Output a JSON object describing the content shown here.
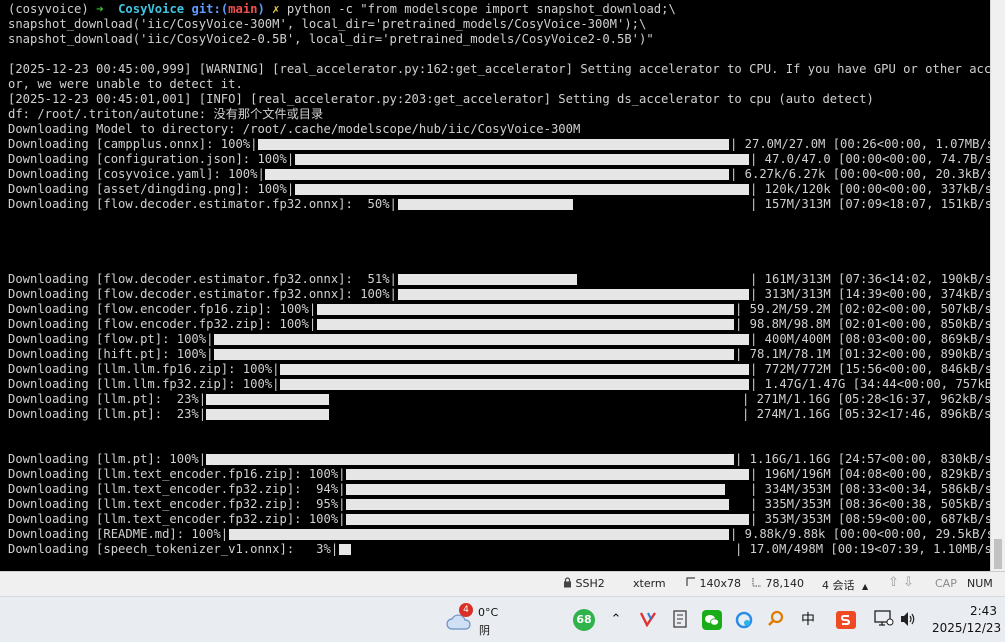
{
  "terminal": {
    "prompt": {
      "env": "(cosyvoice)",
      "arrow": "➜",
      "dir": "CosyVoice",
      "git_label": "git:(",
      "branch": "main",
      "git_close": ")",
      "dirty": "✗",
      "command": "python -c \"from modelscope import snapshot_download;\\"
    },
    "command_cont": [
      "snapshot_download('iic/CosyVoice-300M', local_dir='pretrained_models/CosyVoice-300M');\\",
      "snapshot_download('iic/CosyVoice2-0.5B', local_dir='pretrained_models/CosyVoice2-0.5B')\""
    ],
    "log_lines": [
      "[2025-12-23 00:45:00,999] [WARNING] [real_accelerator.py:162:get_accelerator] Setting accelerator to CPU. If you have GPU or other accelerat",
      "or, we were unable to detect it.",
      "[2025-12-23 00:45:01,001] [INFO] [real_accelerator.py:203:get_accelerator] Setting ds_accelerator to cpu (auto detect)",
      "df: /root/.triton/autotune: 没有那个文件或目录",
      "Downloading Model to directory: /root/.cache/modelscope/hub/iic/CosyVoice-300M"
    ],
    "downloads": [
      {
        "prefix": "Downloading [campplus.onnx]: 100%|",
        "percent": 100,
        "stats": "| 27.0M/27.0M [00:26<00:00, 1.07MB/s]"
      },
      {
        "prefix": "Downloading [configuration.json]: 100%|",
        "percent": 100,
        "stats": "| 47.0/47.0 [00:00<00:00, 74.7B/s]"
      },
      {
        "prefix": "Downloading [cosyvoice.yaml]: 100%|",
        "percent": 100,
        "stats": "| 6.27k/6.27k [00:00<00:00, 20.3kB/s]"
      },
      {
        "prefix": "Downloading [asset/dingding.png]: 100%|",
        "percent": 100,
        "stats": "| 120k/120k [00:00<00:00, 337kB/s]"
      },
      {
        "prefix": "Downloading [flow.decoder.estimator.fp32.onnx]:  50%|",
        "percent": 50,
        "stats": "| 157M/313M [07:09<18:07, 151kB/s]"
      },
      {
        "prefix": "Downloading [flow.decoder.estimator.fp32.onnx]:  51%|",
        "percent": 51,
        "stats": "| 161M/313M [07:36<14:02, 190kB/s]"
      },
      {
        "prefix": "Downloading [flow.decoder.estimator.fp32.onnx]: 100%|",
        "percent": 100,
        "stats": "| 313M/313M [14:39<00:00, 374kB/s]"
      },
      {
        "prefix": "Downloading [flow.encoder.fp16.zip]: 100%|",
        "percent": 100,
        "stats": "| 59.2M/59.2M [02:02<00:00, 507kB/s]"
      },
      {
        "prefix": "Downloading [flow.encoder.fp32.zip]: 100%|",
        "percent": 100,
        "stats": "| 98.8M/98.8M [02:01<00:00, 850kB/s]"
      },
      {
        "prefix": "Downloading [flow.pt]: 100%|",
        "percent": 100,
        "stats": "| 400M/400M [08:03<00:00, 869kB/s]"
      },
      {
        "prefix": "Downloading [hift.pt]: 100%|",
        "percent": 100,
        "stats": "| 78.1M/78.1M [01:32<00:00, 890kB/s]"
      },
      {
        "prefix": "Downloading [llm.llm.fp16.zip]: 100%|",
        "percent": 100,
        "stats": "| 772M/772M [15:56<00:00, 846kB/s]"
      },
      {
        "prefix": "Downloading [llm.llm.fp32.zip]: 100%|",
        "percent": 100,
        "stats": "| 1.47G/1.47G [34:44<00:00, 757kB/s]"
      },
      {
        "prefix": "Downloading [llm.pt]:  23%|",
        "percent": 23,
        "stats": "| 271M/1.16G [05:28<16:37, 962kB/s]"
      },
      {
        "prefix": "Downloading [llm.pt]:  23%|",
        "percent": 23,
        "stats": "| 274M/1.16G [05:32<17:46, 896kB/s]"
      },
      {
        "prefix": "Downloading [llm.pt]: 100%|",
        "percent": 100,
        "stats": "| 1.16G/1.16G [24:57<00:00, 830kB/s]"
      },
      {
        "prefix": "Downloading [llm.text_encoder.fp16.zip]: 100%|",
        "percent": 100,
        "stats": "| 196M/196M [04:08<00:00, 829kB/s]"
      },
      {
        "prefix": "Downloading [llm.text_encoder.fp32.zip]:  94%|",
        "percent": 94,
        "stats": "| 334M/353M [08:33<00:34, 586kB/s]"
      },
      {
        "prefix": "Downloading [llm.text_encoder.fp32.zip]:  95%|",
        "percent": 95,
        "stats": "| 335M/353M [08:36<00:38, 505kB/s]"
      },
      {
        "prefix": "Downloading [llm.text_encoder.fp32.zip]: 100%|",
        "percent": 100,
        "stats": "| 353M/353M [08:59<00:00, 687kB/s]"
      },
      {
        "prefix": "Downloading [README.md]: 100%|",
        "percent": 100,
        "stats": "| 9.88k/9.88k [00:00<00:00, 29.5kB/s]"
      },
      {
        "prefix": "Downloading [speech_tokenizer_v1.onnx]:   3%|",
        "percent": 3,
        "stats": "| 17.0M/498M [00:19<07:39, 1.10MB/s]"
      }
    ]
  },
  "statusbar": {
    "ssh": "SSH2",
    "term": "xterm",
    "size": "140x78",
    "cursor_pos": "78,140",
    "sessions": "4 会话",
    "cap": "CAP",
    "num": "NUM"
  },
  "taskbar": {
    "weather_temp": "0°C",
    "weather_desc": "阴",
    "weather_badge": "4",
    "tray_counter": "68",
    "ime": "中",
    "time": "2:43",
    "date": "2025/12/23",
    "colors": {
      "counter": "#2fb34a",
      "badge": "#d93025"
    }
  }
}
